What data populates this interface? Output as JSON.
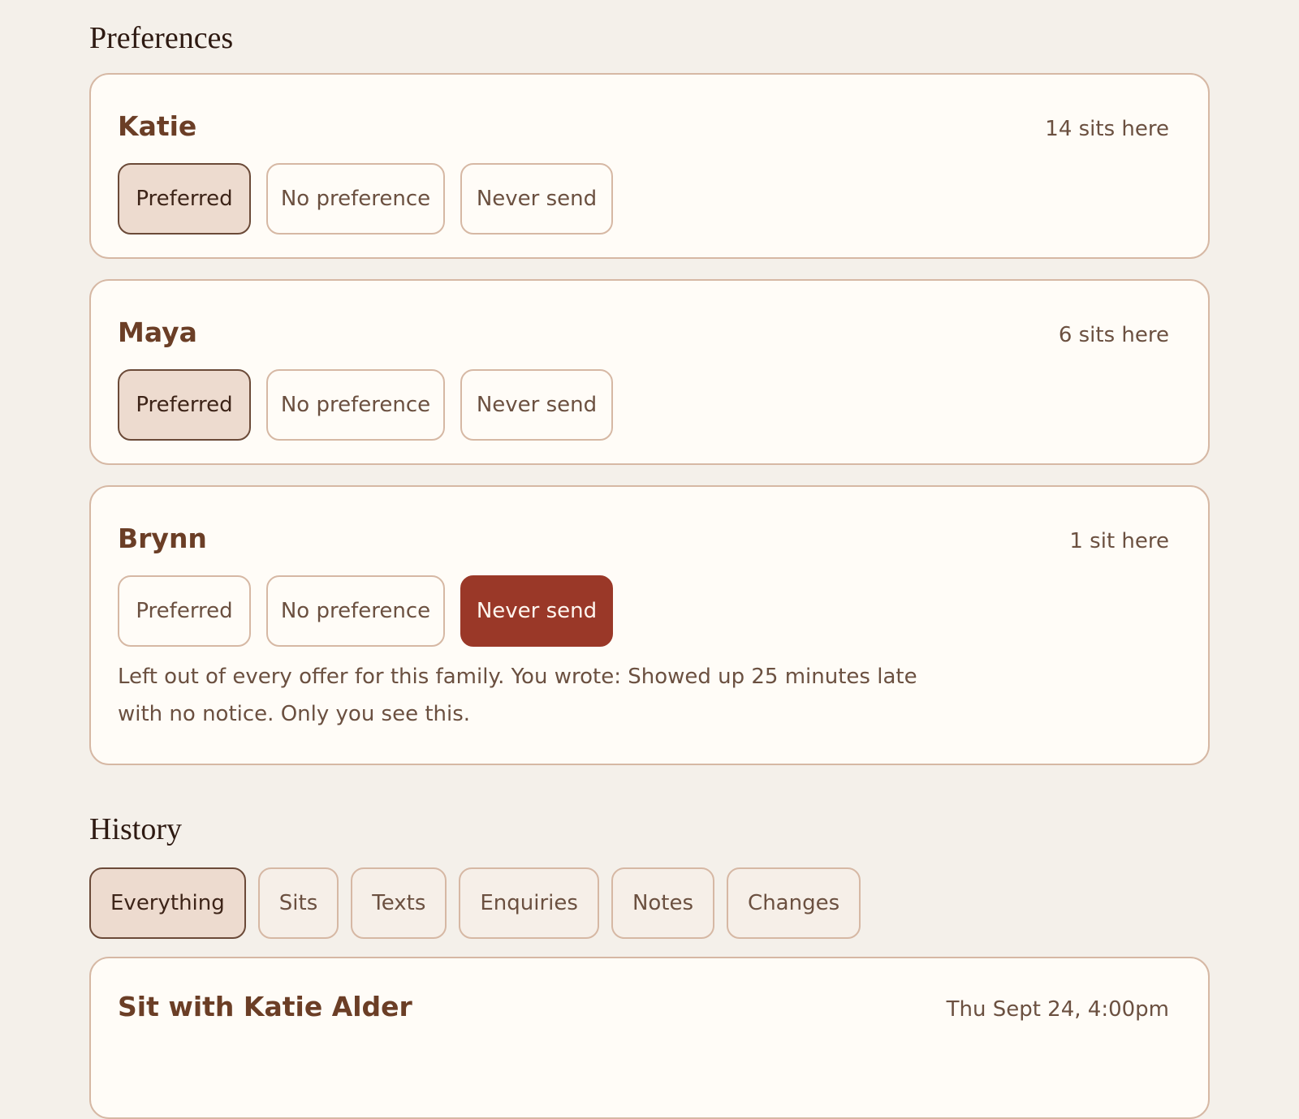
{
  "preferences": {
    "title": "Preferences",
    "options": {
      "preferred": "Preferred",
      "no_preference": "No preference",
      "never_send": "Never send"
    },
    "sitters": [
      {
        "name": "Katie",
        "sits": "14 sits here",
        "selected": "preferred"
      },
      {
        "name": "Maya",
        "sits": "6 sits here",
        "selected": "preferred"
      },
      {
        "name": "Brynn",
        "sits": "1 sit here",
        "selected": "never_send",
        "note": "Left out of every offer for this family. You wrote: Showed up 25 minutes late with no notice. Only you see this."
      }
    ]
  },
  "history": {
    "title": "History",
    "tabs": [
      "Everything",
      "Sits",
      "Texts",
      "Enquiries",
      "Notes",
      "Changes"
    ],
    "selected_tab": 0,
    "entries": [
      {
        "title": "Sit with Katie Alder",
        "date": "Thu Sept 24, 4:00pm"
      }
    ]
  },
  "colors": {
    "background": "#f4f0ea",
    "card": "#fffcf7",
    "border": "#d6b8a4",
    "selected": "#eddbcf",
    "danger": "#9a3828",
    "accent_text": "#6b3e26"
  }
}
